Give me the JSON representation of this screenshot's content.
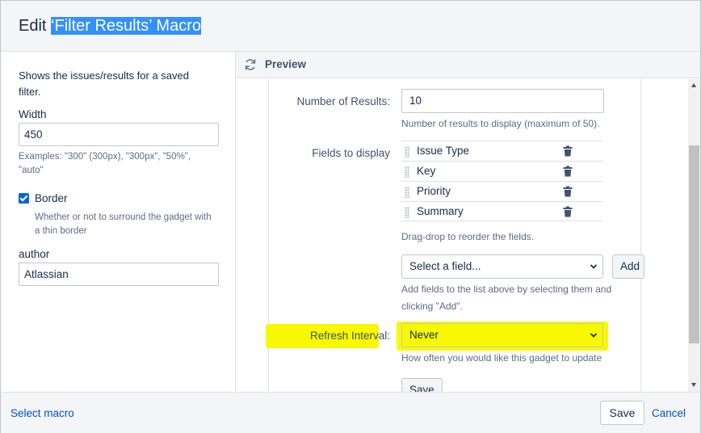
{
  "header": {
    "title_prefix": "Edit ",
    "title_highlight": "‘Filter Results’ Macro"
  },
  "left": {
    "description": "Shows the issues/results for a saved filter.",
    "width_label": "Width",
    "width_value": "450",
    "width_hint": "Examples: \"300\" (300px), \"300px\", \"50%\", \"auto\"",
    "border_label": "Border",
    "border_checked": true,
    "border_hint": "Whether or not to surround the gadget with a thin border",
    "author_label": "author",
    "author_value": "Atlassian"
  },
  "preview": {
    "label": "Preview",
    "number_label": "Number of Results:",
    "number_value": "10",
    "number_hint": "Number of results to display (maximum of 50).",
    "fields_label": "Fields to display",
    "fields": [
      "Issue Type",
      "Key",
      "Priority",
      "Summary"
    ],
    "fields_hint": "Drag-drop to reorder the fields.",
    "select_field": "Select a field...",
    "add_button": "Add",
    "add_hint": "Add fields to the list above by selecting them and clicking \"Add\".",
    "refresh_label": "Refresh Interval:",
    "refresh_value": "Never",
    "refresh_hint": "How often you would like this gadget to update",
    "save_button": "Save"
  },
  "footer": {
    "select_macro": "Select macro",
    "save": "Save",
    "cancel": "Cancel"
  },
  "colors": {
    "highlight": "#f8f800",
    "link": "#0052cc",
    "selection": "#3390ff"
  },
  "icons": [
    "refresh-icon",
    "drag-handle-icon",
    "trash-icon",
    "chevron-down-icon",
    "checkbox-checked-icon"
  ]
}
